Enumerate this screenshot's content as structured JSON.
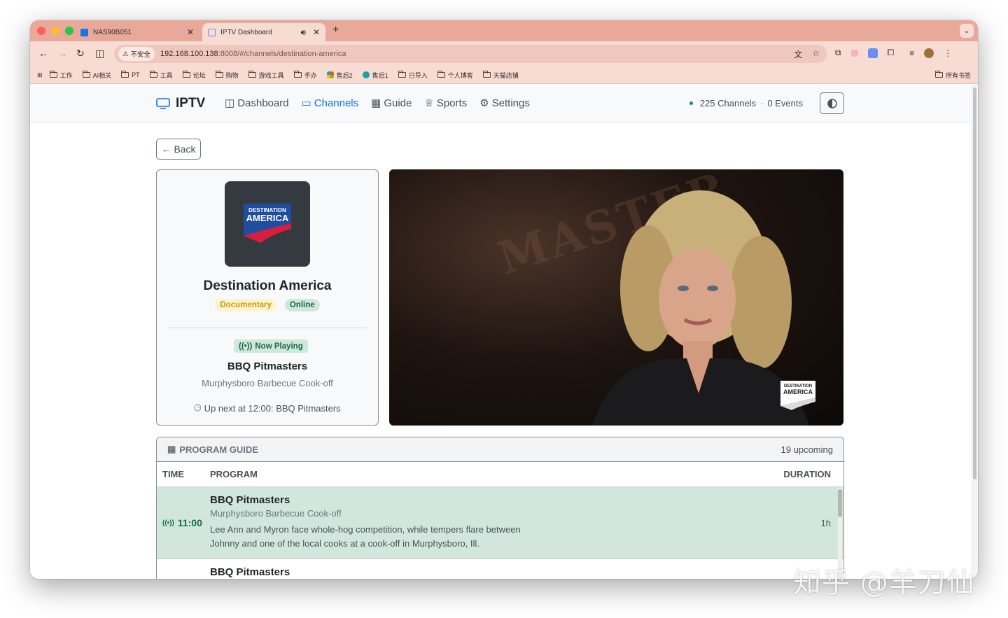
{
  "browser": {
    "tabs": [
      {
        "title": "NAS90B051",
        "active": false
      },
      {
        "title": "IPTV Dashboard",
        "active": true
      }
    ],
    "security_label": "不安全",
    "url_host": "192.168.100.138",
    "url_path": ":8008/#/channels/destination-america",
    "bookmarks": [
      "工作",
      "AI相关",
      "PT",
      "工具",
      "论坛",
      "购物",
      "游戏工具",
      "手办",
      "售后2",
      "售后1",
      "已导入",
      "个人博客",
      "天猫店铺"
    ],
    "all_bookmarks": "所有书签"
  },
  "app": {
    "brand": "IPTV",
    "nav": [
      "Dashboard",
      "Channels",
      "Guide",
      "Sports",
      "Settings"
    ],
    "active_nav": "Channels",
    "channel_count": "225 Channels",
    "separator": "·",
    "events": "0 Events",
    "back_label": "Back"
  },
  "channel": {
    "name": "Destination America",
    "category": "Documentary",
    "status": "Online",
    "logo_line1": "DESTINATION",
    "logo_line2": "AMERICA",
    "now_playing_label": "Now Playing",
    "now_title": "BBQ Pitmasters",
    "now_subtitle": "Murphysboro Barbecue Cook-off",
    "up_next": "Up next at 12:00: BBQ Pitmasters"
  },
  "player": {
    "bg_text": "MASTER",
    "overlay_logo_line1": "DESTINATION",
    "overlay_logo_line2": "AMERICA"
  },
  "guide": {
    "title": "PROGRAM GUIDE",
    "count": "19 upcoming",
    "columns": {
      "time": "TIME",
      "program": "PROGRAM",
      "duration": "DURATION"
    },
    "rows": [
      {
        "time": "11:00",
        "title": "BBQ Pitmasters",
        "subtitle": "Murphysboro Barbecue Cook-off",
        "description": "Lee Ann and Myron face whole-hog competition, while tempers flare between Johnny and one of the local cooks at a cook-off in Murphysboro, Ill.",
        "duration": "1h",
        "current": true
      },
      {
        "time": "",
        "title": "BBQ Pitmasters",
        "subtitle": "",
        "description": "",
        "duration": "",
        "current": false
      }
    ]
  },
  "watermark": "知乎 @羊刀仙",
  "colors": {
    "tabstrip": "#e8a99a",
    "toolbar": "#f7dcd4",
    "accent": "#0d6efd",
    "success": "#146c43"
  }
}
